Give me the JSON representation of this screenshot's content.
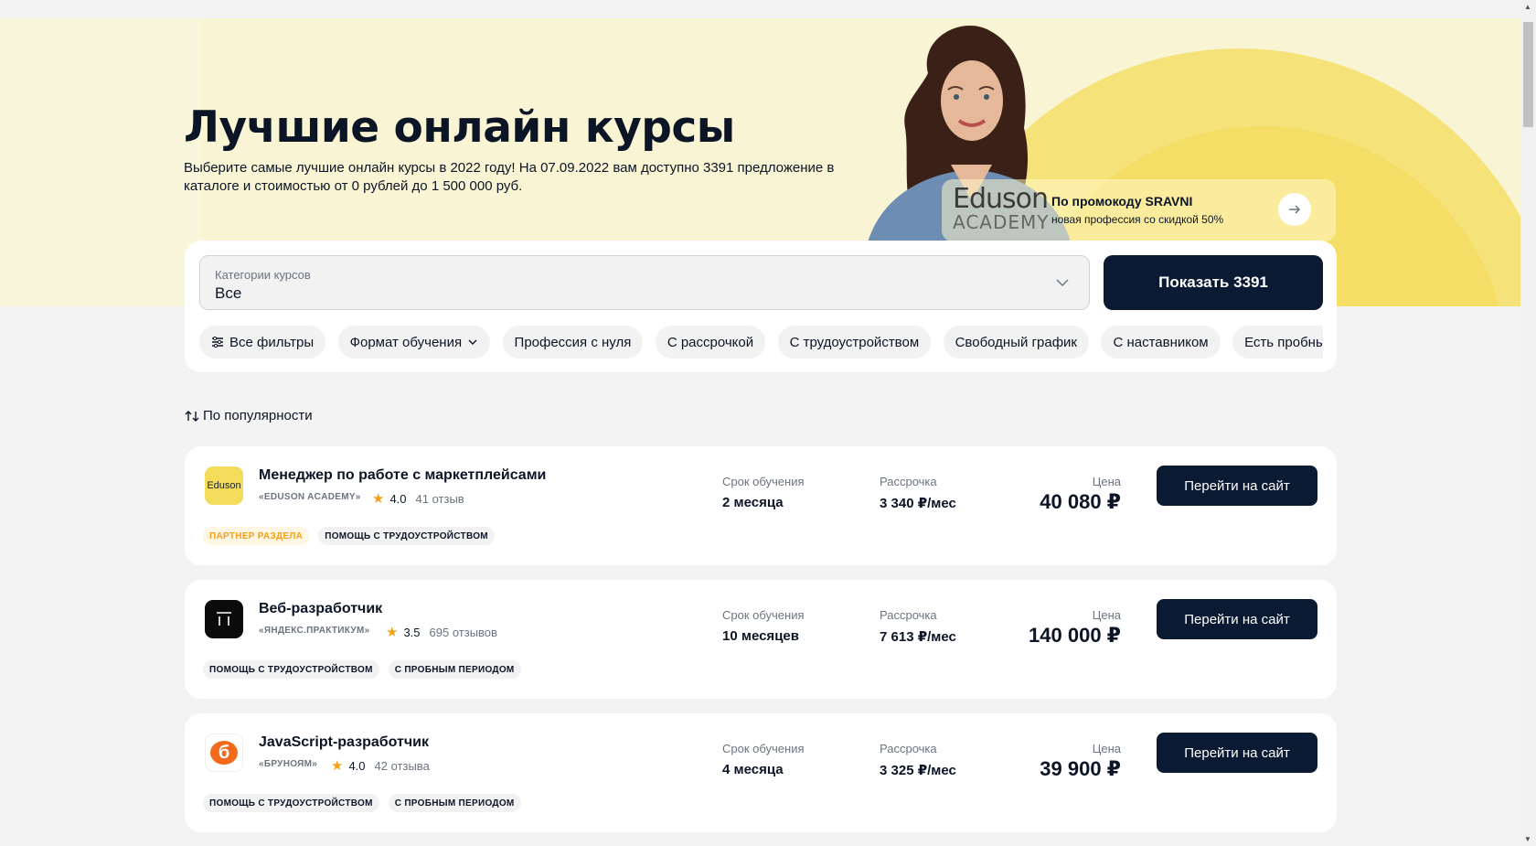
{
  "hero": {
    "title": "Лучшие онлайн курсы",
    "subtitle": "Выберите самые лучшие онлайн курсы в 2022 году! На 07.09.2022 вам доступно 3391 предложение в каталоге и стоимостью от 0 рублей до 1 500 000 руб."
  },
  "promo": {
    "logo_line1": "Eduson",
    "logo_line2": "ACADEMY",
    "title": "По промокоду SRAVNI",
    "subtitle": "новая профессия со скидкой 50%"
  },
  "filter": {
    "select_label": "Категории курсов",
    "select_value": "Все",
    "show_button": "Показать 3391",
    "chips": [
      "Все фильтры",
      "Формат обучения",
      "Профессия с нуля",
      "С рассрочкой",
      "С трудоустройством",
      "Свободный график",
      "С наставником",
      "Есть пробный"
    ]
  },
  "sort": {
    "label": "По популярности"
  },
  "courses": [
    {
      "title": "Менеджер по работе с маркетплейсами",
      "school": "«EDUSON ACADEMY»",
      "logo_text": "Eduson",
      "rating": "4.0",
      "reviews": "41 отзыв",
      "tags": [
        "ПАРТНЕР РАЗДЕЛА",
        "ПОМОЩЬ С ТРУДОУСТРОЙСТВОМ"
      ],
      "duration_label": "Срок обучения",
      "duration": "2 месяца",
      "installment_label": "Рассрочка",
      "installment": "3 340 ₽/мес",
      "price_label": "Цена",
      "price": "40 080 ₽",
      "button": "Перейти на сайт"
    },
    {
      "title": "Веб-разработчик",
      "school": "«ЯНДЕКС.ПРАКТИКУМ»",
      "logo_text": "",
      "rating": "3.5",
      "reviews": "695 отзывов",
      "tags": [
        "ПОМОЩЬ С ТРУДОУСТРОЙСТВОМ",
        "С ПРОБНЫМ ПЕРИОДОМ"
      ],
      "duration_label": "Срок обучения",
      "duration": "10 месяцев",
      "installment_label": "Рассрочка",
      "installment": "7 613 ₽/мес",
      "price_label": "Цена",
      "price": "140 000 ₽",
      "button": "Перейти на сайт"
    },
    {
      "title": "JavaScript-разработчик",
      "school": "«БРУНОЯМ»",
      "logo_text": "б",
      "rating": "4.0",
      "reviews": "42 отзыва",
      "tags": [
        "ПОМОЩЬ С ТРУДОУСТРОЙСТВОМ",
        "С ПРОБНЫМ ПЕРИОДОМ"
      ],
      "duration_label": "Срок обучения",
      "duration": "4 месяца",
      "installment_label": "Рассрочка",
      "installment": "3 325 ₽/мес",
      "price_label": "Цена",
      "price": "39 900 ₽",
      "button": "Перейти на сайт"
    }
  ],
  "colors": {
    "accent_dark": "#0b1a33",
    "hero_bg": "#f9f4d3",
    "sun": "#f5e37a",
    "star": "#f4a01a"
  }
}
